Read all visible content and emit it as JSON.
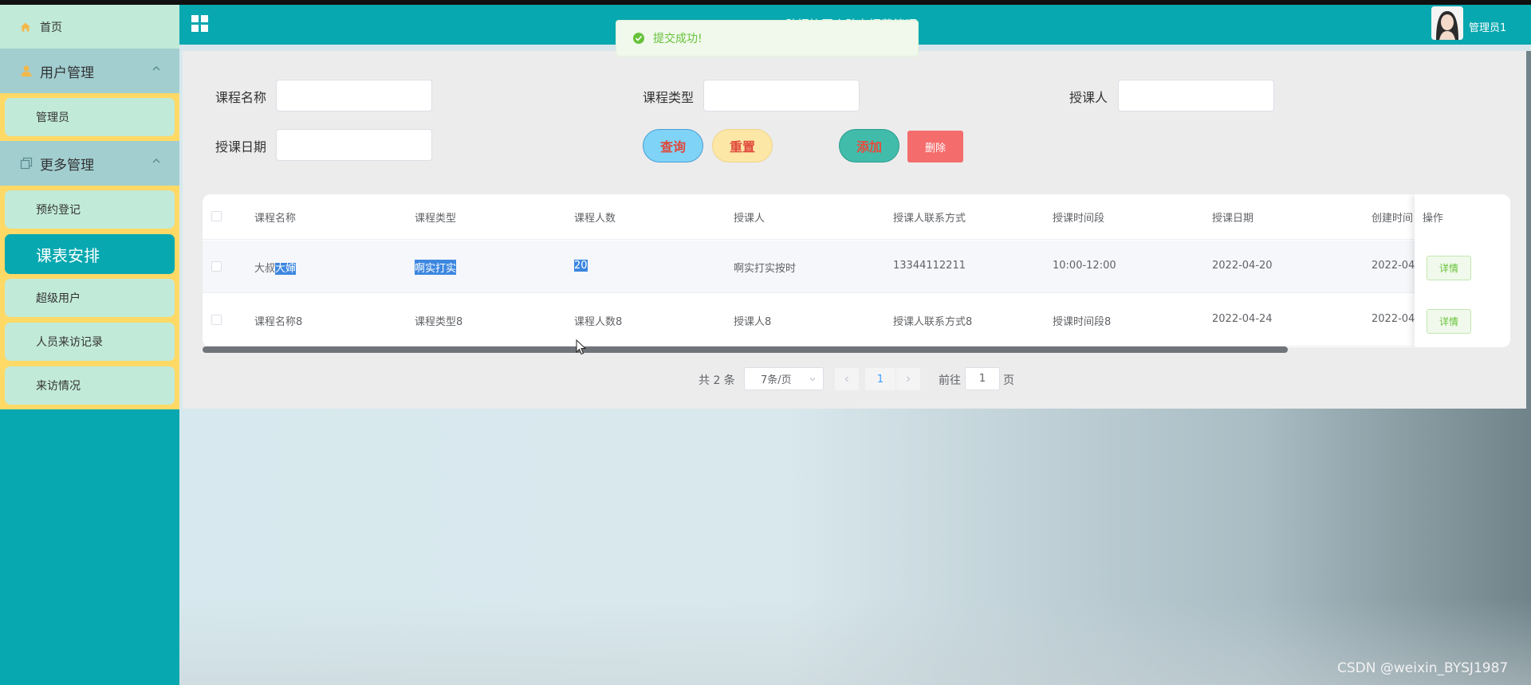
{
  "header": {
    "site_title": "助招协同小助力招募管理",
    "user_name": "管理员1",
    "toast": "提交成功!"
  },
  "sidebar": {
    "home": "首页",
    "groups": [
      {
        "label": "用户管理",
        "items": [
          "管理员"
        ]
      },
      {
        "label": "更多管理",
        "items": [
          "预约登记",
          "课表安排",
          "超级用户",
          "人员来访记录",
          "来访情况"
        ]
      }
    ],
    "active_item": "课表安排"
  },
  "search": {
    "course_name_label": "课程名称",
    "course_type_label": "课程类型",
    "teacher_label": "授课人",
    "date_label": "授课日期",
    "course_name_value": "",
    "course_type_value": "",
    "teacher_value": "",
    "date_value": ""
  },
  "actions": {
    "query": "查询",
    "reset": "重置",
    "add": "添加",
    "delete": "删除"
  },
  "table": {
    "columns": [
      "课程名称",
      "课程类型",
      "课程人数",
      "授课人",
      "授课人联系方式",
      "授课时间段",
      "授课日期",
      "创建时间",
      "操作"
    ],
    "rows": [
      {
        "name_prefix": "大叔",
        "name_selected": "大婶",
        "type": "啊实打实",
        "count": "20",
        "teacher": "啊实打实按时",
        "phone": "13344112211",
        "time": "10:00-12:00",
        "date": "2022-04-20",
        "created": "2022-04",
        "detail": "详情"
      },
      {
        "name": "课程名称8",
        "type": "课程类型8",
        "count": "课程人数8",
        "teacher": "授课人8",
        "phone": "授课人联系方式8",
        "time": "授课时间段8",
        "date": "2022-04-24",
        "created": "2022-04",
        "detail": "详情"
      }
    ]
  },
  "pagination": {
    "total": "共 2 条",
    "page_size": "7条/页",
    "current_page": "1",
    "goto_label": "前往",
    "goto_value": "1",
    "page_unit": "页"
  },
  "watermark": "CSDN @weixin_BYSJ1987",
  "colors": {
    "sidebar_teal": "#07a8b0",
    "sidebar_item": "#c2ead9",
    "sidebar_group": "#a2ced0",
    "sidebar_sub_bg": "#ffd966",
    "selection": "#3c87e0",
    "danger": "#f56c6c",
    "success": "#67c23a"
  },
  "icons": [
    "home-icon",
    "user-icon",
    "copy-icon",
    "chevron-up-icon",
    "grid-menu-icon",
    "success-check-icon",
    "chevron-left-icon",
    "chevron-right-icon",
    "chevron-down-icon",
    "mouse-cursor-icon"
  ]
}
